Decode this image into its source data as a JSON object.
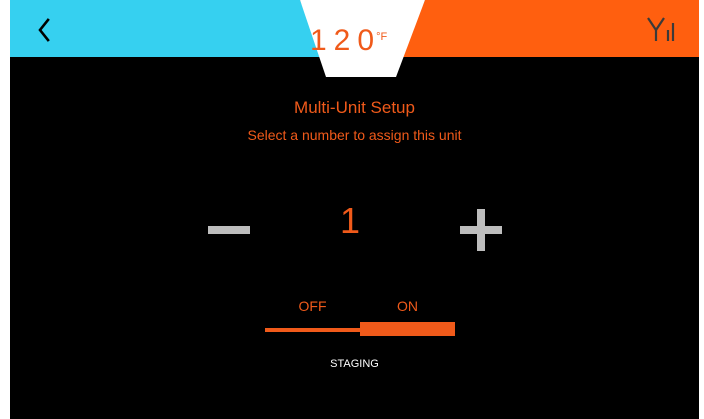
{
  "header": {
    "temperature_value": "120",
    "temperature_unit": "°F",
    "back_icon": "chevron-left-icon",
    "signal_icon": "signal-icon",
    "colors": {
      "left_band": "#36d0f0",
      "right_band": "#ff5f0f",
      "center_tab": "#ffffff"
    }
  },
  "setup": {
    "title": "Multi-Unit Setup",
    "subtitle": "Select a number to assign this unit",
    "unit_number": "1",
    "decrement_icon": "minus-icon",
    "increment_icon": "plus-icon"
  },
  "staging": {
    "off_label": "OFF",
    "on_label": "ON",
    "selected": "ON",
    "caption": "STAGING"
  },
  "theme": {
    "accent": "#f05a1a",
    "background": "#000000",
    "control_gray": "#bdbdbd"
  }
}
